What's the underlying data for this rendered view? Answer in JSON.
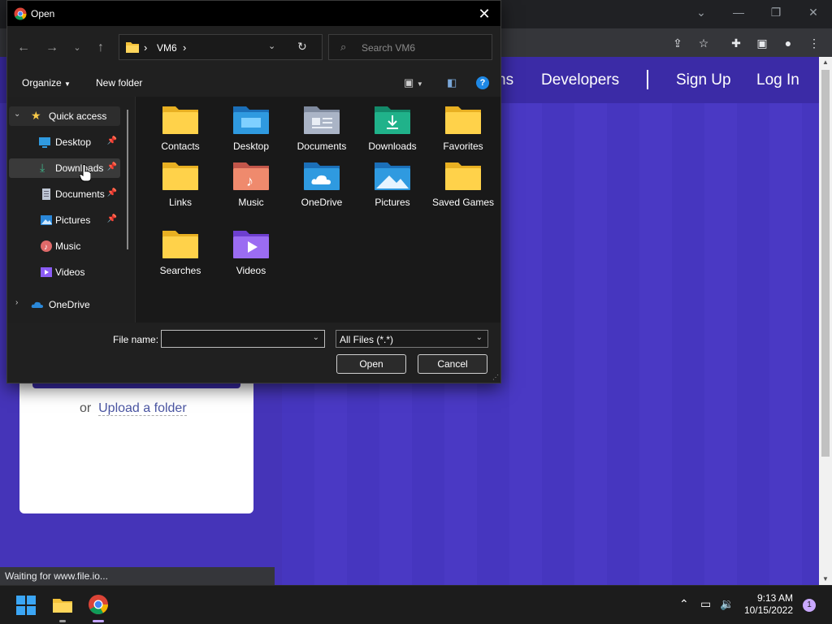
{
  "browser": {
    "window_controls": {
      "minimize": "—",
      "restore": "❐",
      "close": "✕",
      "tabs_dropdown": "⌄"
    },
    "toolbar_icons": [
      "share-icon",
      "bookmark-star-icon",
      "extensions-icon",
      "sidepanel-icon",
      "profile-icon",
      "menu-icon"
    ],
    "status_text": "Waiting for www.file.io..."
  },
  "site": {
    "nav": {
      "partial_link": "ns",
      "developers": "Developers",
      "signup": "Sign Up",
      "login": "Log In"
    },
    "upload": {
      "or": "or",
      "folder_link": "Upload a folder"
    },
    "colors": {
      "background": "#4534b8",
      "nav": "#3b2ba6"
    }
  },
  "dialog": {
    "title": "Open",
    "address": {
      "root_sep": "›",
      "folder": "VM6",
      "trail_sep": "›"
    },
    "search_placeholder": "Search VM6",
    "commands": {
      "organize": "Organize",
      "new_folder": "New folder"
    },
    "nav_pane": [
      {
        "label": "Quick access",
        "icon": "star-icon"
      },
      {
        "label": "Desktop",
        "icon": "desktop-icon",
        "pinned": true
      },
      {
        "label": "Downloads",
        "icon": "download-icon",
        "pinned": true
      },
      {
        "label": "Documents",
        "icon": "documents-icon",
        "pinned": true
      },
      {
        "label": "Pictures",
        "icon": "pictures-icon",
        "pinned": true
      },
      {
        "label": "Music",
        "icon": "music-icon"
      },
      {
        "label": "Videos",
        "icon": "videos-icon"
      },
      {
        "label": "OneDrive",
        "icon": "onedrive-icon"
      }
    ],
    "folders": [
      {
        "label": "Contacts",
        "icon": "folder-icon"
      },
      {
        "label": "Desktop",
        "icon": "desktop-folder-icon"
      },
      {
        "label": "Documents",
        "icon": "documents-folder-icon"
      },
      {
        "label": "Downloads",
        "icon": "downloads-folder-icon"
      },
      {
        "label": "Favorites",
        "icon": "folder-icon"
      },
      {
        "label": "Links",
        "icon": "folder-icon"
      },
      {
        "label": "Music",
        "icon": "music-folder-icon"
      },
      {
        "label": "OneDrive",
        "icon": "onedrive-folder-icon"
      },
      {
        "label": "Pictures",
        "icon": "pictures-folder-icon"
      },
      {
        "label": "Saved Games",
        "icon": "folder-icon"
      },
      {
        "label": "Searches",
        "icon": "folder-icon"
      },
      {
        "label": "Videos",
        "icon": "videos-folder-icon"
      }
    ],
    "footer": {
      "file_name_label": "File name:",
      "file_name_value": "",
      "filter": "All Files (*.*)",
      "open": "Open",
      "cancel": "Cancel"
    }
  },
  "taskbar": {
    "time": "9:13 AM",
    "date": "10/15/2022",
    "notification_count": "1"
  }
}
